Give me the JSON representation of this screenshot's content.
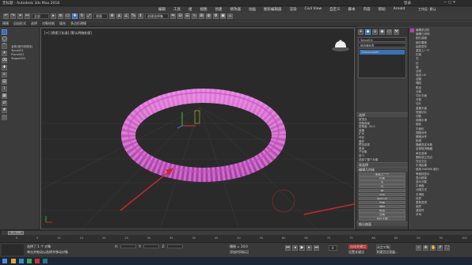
{
  "titlebar": {
    "title": "无标题 - Autodesk 3ds Max 2018",
    "login": "登录",
    "workspace_label": "工作区: 默认"
  },
  "menubar": {
    "items": [
      "编辑",
      "工具",
      "组",
      "视图",
      "创建",
      "修改器",
      "动画",
      "图形编辑器",
      "渲染",
      "Civil View",
      "自定义",
      "脚本",
      "内容",
      "帮助",
      "Arnold"
    ]
  },
  "toolbar": {
    "filter_value": "全部",
    "view_value": "视图",
    "selection_set_value": "创建选择集"
  },
  "ribbon": {
    "items": [
      "建模",
      "自由形式",
      "选择",
      "对象绘制",
      "填充"
    ],
    "sub_items": [
      "多边形建模"
    ]
  },
  "scene_explorer": {
    "items": [
      "名称(按升序排序)",
      "Torus001",
      "Plane001",
      "Teapot001"
    ]
  },
  "viewport": {
    "label": "[+] [透视] [标准] [默认明暗处理]"
  },
  "command_panel": {
    "object_name": "Torus001",
    "modifier_list": "修改器列表",
    "stack_item": "Turbosmooth",
    "rollouts": {
      "selection": "选择",
      "soft_selection": "软选择",
      "edit_geometry": "编辑几何体",
      "subdivision_surface": "细分曲面"
    },
    "selection_rows": [
      "按顶点",
      "忽略背面",
      "按角度: 45.0",
      "收缩",
      "扩大",
      "环形",
      "循环",
      "预览选择",
      "禁用",
      "子对象",
      "多个",
      "选择了整个对象"
    ],
    "edit_geometry_rows": [
      "重复上一个",
      "约束",
      "无",
      "边",
      "面",
      "法线",
      "保持 UV",
      "创建",
      "塌陷",
      "附加",
      "分离",
      "切片平面",
      "分割",
      "切片",
      "重置平面",
      "快速切片",
      "切割",
      "网格平滑",
      "细化",
      "平面化",
      "X",
      "Y",
      "Z",
      "视图对齐",
      "栅格对齐",
      "松弛",
      "隐藏选定对象",
      "全部取消隐藏",
      "隐藏未选定对象",
      "命名选择:",
      "复制",
      "粘贴",
      "删除孤立顶点",
      "完全交互"
    ],
    "subdivision_rows": [
      "平滑结果",
      "使用 NURMS 细分",
      "等值线显示",
      "显示框架",
      "显示",
      "迭代次数: 1",
      "平滑度: 1.0",
      "渲染",
      "迭代次数: 0",
      "平滑度: 1.0",
      "分隔方式",
      "平滑组",
      "材质",
      "更新选项",
      "始终",
      "渲染时",
      "手动",
      "更新"
    ]
  },
  "right_panel": {
    "rows": [
      "编辑多边形",
      "编辑几何体",
      "细分曲面",
      "细分置换",
      "绘制变形",
      "重复上一个",
      "约束",
      "无",
      "边",
      "面",
      "法线",
      "保持 UV",
      "创建",
      "塌陷",
      "附加",
      "分离",
      "切片平面",
      "分割",
      "切片",
      "重置平面",
      "快速切片",
      "切割",
      "网格平滑",
      "细化",
      "平面化",
      "视图对齐",
      "栅格对齐",
      "松弛",
      "隐藏选定对象",
      "全部取消隐藏",
      "命名选择",
      "删除孤立顶点",
      "完全交互",
      "平滑结果",
      "使用 NURMS 细分",
      "等值线显示",
      "显示框架",
      "迭代次数",
      "平滑度",
      "分隔方式",
      "平滑组",
      "材质",
      "更新选项",
      "始终",
      "渲染时",
      "手动"
    ]
  },
  "timeline": {
    "frame_label": "0 / 100",
    "ticks": [
      "0",
      "5",
      "10",
      "15",
      "20",
      "25",
      "30",
      "35",
      "40",
      "45",
      "50",
      "55",
      "60",
      "65",
      "70",
      "75",
      "80",
      "85",
      "90",
      "95",
      "100"
    ]
  },
  "status": {
    "selection_text": "选择了 1 个 对象",
    "hint_text": "单击并拖动以选择并移动对象",
    "x_label": "X:",
    "y_label": "Y:",
    "z_label": "Z:",
    "grid_label": "栅格 = 10.0",
    "auto_key": "自动关键点",
    "set_key": "设置关键点",
    "selected_label": "选定对象",
    "key_filters": "关键点过滤器...",
    "time_tag": "添加时间标记",
    "frame_value": "0"
  },
  "colors": {
    "torus": "#d35ccf",
    "arrow": "#c8282c",
    "accent": "#3b6fb3",
    "object_color_swatch": "#b740b5"
  },
  "icons": [
    "undo-icon",
    "redo-icon",
    "link-icon",
    "unlink-icon",
    "select-icon",
    "move-icon",
    "rotate-icon",
    "scale-icon",
    "snap-icon",
    "mirror-icon",
    "align-icon",
    "render-icon",
    "teapot-icon"
  ]
}
